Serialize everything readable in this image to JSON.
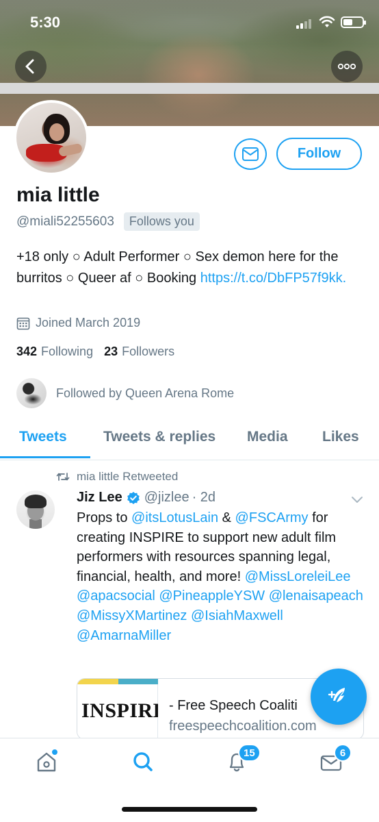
{
  "status_bar": {
    "time": "5:30",
    "battery_level": 0.5
  },
  "profile": {
    "name": "mia little",
    "handle": "@miali52255603",
    "follows_you": "Follows you",
    "follow_label": "Follow",
    "bio_text": "+18 only ○ Adult Performer ○ Sex demon here for the burritos ○ Queer af ○ Booking ",
    "bio_link": "https://t.co/DbFP57f9kk.",
    "joined": "Joined March 2019",
    "following_count": "342",
    "following_label": "Following",
    "followers_count": "23",
    "followers_label": "Followers",
    "followed_by": "Followed by Queen Arena Rome"
  },
  "tabs": [
    "Tweets",
    "Tweets & replies",
    "Media",
    "Likes"
  ],
  "tweet": {
    "retweet_label": "mia little Retweeted",
    "author_name": "Jiz Lee",
    "author_handle": "@jizlee",
    "time": "· 2d",
    "text_1": "Props to ",
    "mention_1": "@itsLotusLain",
    "text_2": " & ",
    "mention_2": "@FSCArmy",
    "text_3": " for creating INSPIRE to support new adult film performers with resources spanning legal, financial, health, and more! ",
    "mentions_tail": "@MissLoreleiLee @apacsocial @PineappleYSW @lenaisapeach @MissyXMartinez @IsiahMaxwell @AmarnaMiller",
    "card_image_text": "INSPIRE",
    "card_title": "- Free Speech Coaliti",
    "card_domain": "freespeechcoalition.com"
  },
  "nav": {
    "notifications_badge": "15",
    "messages_badge": "6"
  },
  "colors": {
    "accent": "#1da1f2",
    "secondary_text": "#657786"
  }
}
